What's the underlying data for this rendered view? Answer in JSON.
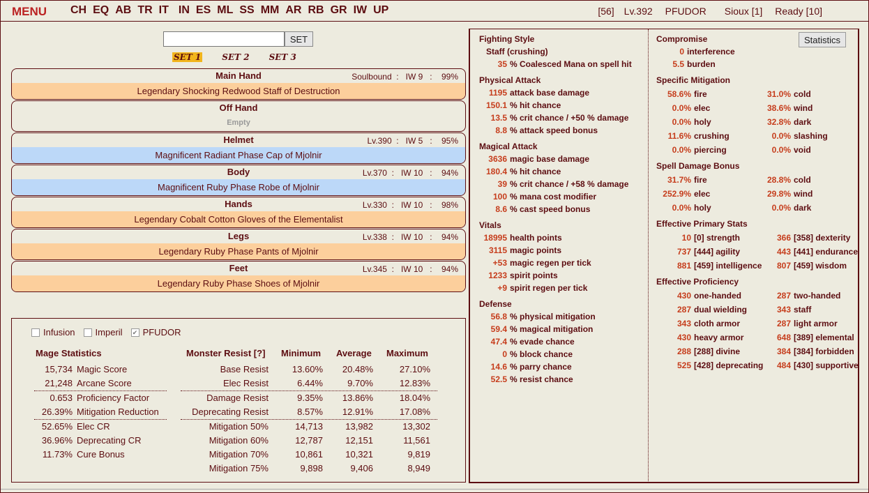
{
  "nav": {
    "menu": "MENU",
    "items": [
      "CH",
      "EQ",
      "AB",
      "TR",
      "IT",
      "IN",
      "ES",
      "ML",
      "SS",
      "MM",
      "AR",
      "RB",
      "GR",
      "IW",
      "UP"
    ]
  },
  "status": {
    "stamina": "[56]",
    "level": "Lv.392",
    "persona": "PFUDOR",
    "server": "Sioux [1]",
    "ready": "Ready [10]"
  },
  "equip_set": {
    "button": "SET",
    "input_value": "",
    "tabs": [
      "SET 1",
      "SET 2",
      "SET 3"
    ],
    "active_tab": 0
  },
  "slots": [
    {
      "name": "Main Hand",
      "meta": "Soulbound  :   IW 9   :    99%",
      "item": "Legendary Shocking Redwood Staff of Destruction",
      "tier": "legendary"
    },
    {
      "name": "Off Hand",
      "meta": "",
      "item": "Empty",
      "tier": "empty"
    },
    {
      "name": "Helmet",
      "meta": "Lv.390  :   IW 5   :    95%",
      "item": "Magnificent Radiant Phase Cap of Mjolnir",
      "tier": "magnificent"
    },
    {
      "name": "Body",
      "meta": "Lv.370  :   IW 10   :    94%",
      "item": "Magnificent Ruby Phase Robe of Mjolnir",
      "tier": "magnificent"
    },
    {
      "name": "Hands",
      "meta": "Lv.330  :   IW 10   :    98%",
      "item": "Legendary Cobalt Cotton Gloves of the Elementalist",
      "tier": "legendary"
    },
    {
      "name": "Legs",
      "meta": "Lv.338  :   IW 10   :    94%",
      "item": "Legendary Ruby Phase Pants of Mjolnir",
      "tier": "legendary"
    },
    {
      "name": "Feet",
      "meta": "Lv.345  :   IW 10   :    94%",
      "item": "Legendary Ruby Phase Shoes of Mjolnir",
      "tier": "legendary"
    }
  ],
  "options": [
    {
      "label": "Infusion",
      "checked": false
    },
    {
      "label": "Imperil",
      "checked": false
    },
    {
      "label": "PFUDOR",
      "checked": true
    }
  ],
  "mage_stats": {
    "title": "Mage Statistics",
    "rows": [
      {
        "value": "15,734",
        "label": "Magic Score"
      },
      {
        "value": "21,248",
        "label": "Arcane Score"
      },
      {
        "value": "0.653",
        "label": "Proficiency Factor"
      },
      {
        "value": "26.39%",
        "label": "Mitigation Reduction"
      },
      {
        "value": "52.65%",
        "label": "Elec CR"
      },
      {
        "value": "36.96%",
        "label": "Deprecating CR"
      },
      {
        "value": "11.73%",
        "label": "Cure Bonus"
      }
    ]
  },
  "monster_resist": {
    "headers": [
      "Monster Resist [?]",
      "Minimum",
      "Average",
      "Maximum"
    ],
    "rows": [
      [
        "Base Resist",
        "13.60%",
        "20.48%",
        "27.10%"
      ],
      [
        "Elec Resist",
        "6.44%",
        "9.70%",
        "12.83%"
      ],
      [
        "Damage Resist",
        "9.35%",
        "13.86%",
        "18.04%"
      ],
      [
        "Deprecating Resist",
        "8.57%",
        "12.91%",
        "17.08%"
      ],
      [
        "Mitigation 50%",
        "14,713",
        "13,982",
        "13,302"
      ],
      [
        "Mitigation 60%",
        "12,787",
        "12,151",
        "11,561"
      ],
      [
        "Mitigation 70%",
        "10,861",
        "10,321",
        "9,819"
      ],
      [
        "Mitigation 75%",
        "9,898",
        "9,406",
        "8,949"
      ]
    ]
  },
  "right_col1": [
    {
      "type": "sec",
      "text": "Fighting Style"
    },
    {
      "type": "plain",
      "text": "Staff (crushing)"
    },
    {
      "type": "stat",
      "v": "35",
      "t": "% Coalesced Mana on spell hit"
    },
    {
      "type": "sec",
      "text": "Physical Attack"
    },
    {
      "type": "stat",
      "v": "1195",
      "t": "attack base damage"
    },
    {
      "type": "stat",
      "v": "150.1",
      "t": "% hit chance"
    },
    {
      "type": "stat",
      "v": "13.5",
      "t": "% crit chance / +50 % damage"
    },
    {
      "type": "stat",
      "v": "8.8",
      "t": "% attack speed bonus"
    },
    {
      "type": "sec",
      "text": "Magical Attack"
    },
    {
      "type": "stat",
      "v": "3636",
      "t": "magic base damage"
    },
    {
      "type": "stat",
      "v": "180.4",
      "t": "% hit chance"
    },
    {
      "type": "stat",
      "v": "39",
      "t": "% crit chance / +58 % damage"
    },
    {
      "type": "stat",
      "v": "100",
      "t": "% mana cost modifier"
    },
    {
      "type": "stat",
      "v": "8.6",
      "t": "% cast speed bonus"
    },
    {
      "type": "sec",
      "text": "Vitals"
    },
    {
      "type": "stat",
      "v": "18995",
      "t": "health points"
    },
    {
      "type": "stat",
      "v": "3115",
      "t": "magic points"
    },
    {
      "type": "stat",
      "v": "+53",
      "t": "magic regen per tick"
    },
    {
      "type": "stat",
      "v": "1233",
      "t": "spirit points"
    },
    {
      "type": "stat",
      "v": "+9",
      "t": "spirit regen per tick"
    },
    {
      "type": "sec",
      "text": "Defense"
    },
    {
      "type": "stat",
      "v": "56.8",
      "t": "% physical mitigation"
    },
    {
      "type": "stat",
      "v": "59.4",
      "t": "% magical mitigation"
    },
    {
      "type": "stat",
      "v": "47.4",
      "t": "% evade chance"
    },
    {
      "type": "stat",
      "v": "0",
      "t": "% block chance"
    },
    {
      "type": "stat",
      "v": "14.6",
      "t": "% parry chance"
    },
    {
      "type": "stat",
      "v": "52.5",
      "t": "% resist chance"
    }
  ],
  "right_col2": {
    "statistics_button": "Statistics",
    "compromise": {
      "title": "Compromise",
      "rows": [
        {
          "v": "0",
          "t": "interference"
        },
        {
          "v": "5.5",
          "t": "burden"
        }
      ]
    },
    "specific_mitigation": {
      "title": "Specific Mitigation",
      "rows": [
        [
          {
            "v": "58.6%",
            "t": "fire"
          },
          {
            "v": "31.0%",
            "t": "cold"
          }
        ],
        [
          {
            "v": "0.0%",
            "t": "elec"
          },
          {
            "v": "38.6%",
            "t": "wind"
          }
        ],
        [
          {
            "v": "0.0%",
            "t": "holy"
          },
          {
            "v": "32.8%",
            "t": "dark"
          }
        ],
        [
          {
            "v": "11.6%",
            "t": "crushing"
          },
          {
            "v": "0.0%",
            "t": "slashing"
          }
        ],
        [
          {
            "v": "0.0%",
            "t": "piercing"
          },
          {
            "v": "0.0%",
            "t": "void"
          }
        ]
      ]
    },
    "spell_damage": {
      "title": "Spell Damage Bonus",
      "rows": [
        [
          {
            "v": "31.7%",
            "t": "fire"
          },
          {
            "v": "28.8%",
            "t": "cold"
          }
        ],
        [
          {
            "v": "252.9%",
            "t": "elec"
          },
          {
            "v": "29.8%",
            "t": "wind"
          }
        ],
        [
          {
            "v": "0.0%",
            "t": "holy"
          },
          {
            "v": "0.0%",
            "t": "dark"
          }
        ]
      ]
    },
    "primary_stats": {
      "title": "Effective Primary Stats",
      "rows": [
        [
          {
            "v": "10",
            "t": "[0] strength"
          },
          {
            "v": "366",
            "t": "[358] dexterity"
          }
        ],
        [
          {
            "v": "737",
            "t": "[444] agility"
          },
          {
            "v": "443",
            "t": "[441] endurance"
          }
        ],
        [
          {
            "v": "881",
            "t": "[459] intelligence"
          },
          {
            "v": "807",
            "t": "[459] wisdom"
          }
        ]
      ]
    },
    "proficiency": {
      "title": "Effective Proficiency",
      "rows": [
        [
          {
            "v": "430",
            "t": "one-handed"
          },
          {
            "v": "287",
            "t": "two-handed"
          }
        ],
        [
          {
            "v": "287",
            "t": "dual wielding"
          },
          {
            "v": "343",
            "t": "staff"
          }
        ],
        [
          {
            "v": "343",
            "t": "cloth armor"
          },
          {
            "v": "287",
            "t": "light armor"
          }
        ],
        [
          {
            "v": "430",
            "t": "heavy armor"
          },
          {
            "v": "648",
            "t": "[389] elemental"
          }
        ],
        [
          {
            "v": "288",
            "t": "[288] divine"
          },
          {
            "v": "384",
            "t": "[384] forbidden"
          }
        ],
        [
          {
            "v": "525",
            "t": "[428] deprecating"
          },
          {
            "v": "484",
            "t": "[430] supportive"
          }
        ]
      ]
    }
  }
}
